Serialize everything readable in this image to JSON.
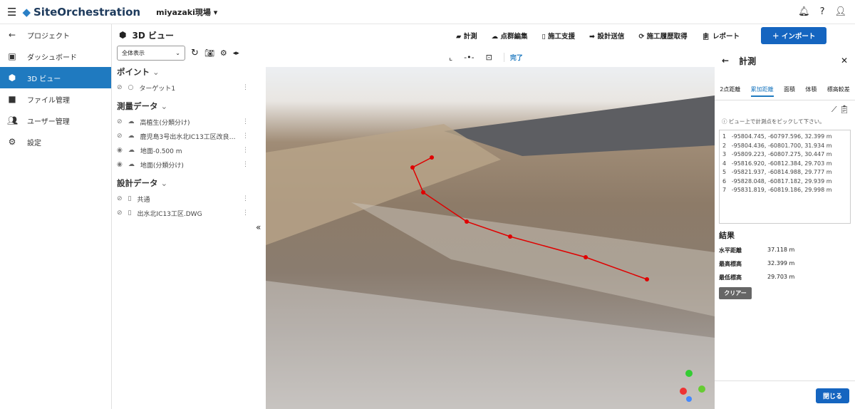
{
  "app": {
    "title": "SiteOrchestration",
    "project": "miyazaki現場"
  },
  "nav": [
    {
      "label": "プロジェクト",
      "icon": "arrow-left-icon"
    },
    {
      "label": "ダッシュボード",
      "icon": "dashboard-icon"
    },
    {
      "label": "3D ビュー",
      "icon": "cube-icon",
      "active": true
    },
    {
      "label": "ファイル管理",
      "icon": "folder-icon"
    },
    {
      "label": "ユーザー管理",
      "icon": "users-icon"
    },
    {
      "label": "設定",
      "icon": "gear-icon"
    }
  ],
  "layers": {
    "title": "3D ビュー",
    "view_select": "全体表示",
    "sections": [
      {
        "title": "ポイント",
        "items": [
          {
            "label": "ターゲット1",
            "visible": false
          }
        ]
      },
      {
        "title": "測量データ",
        "items": [
          {
            "label": "高植生(分類分け)",
            "visible": false
          },
          {
            "label": "鹿児島3号出水北IC13工区改良…",
            "visible": false
          },
          {
            "label": "地面-0.500 m",
            "visible": true
          },
          {
            "label": "地面(分類分け)",
            "visible": true
          }
        ]
      },
      {
        "title": "設計データ",
        "items": [
          {
            "label": "共通",
            "visible": false
          },
          {
            "label": "出水北IC13工区.DWG",
            "visible": false
          }
        ]
      }
    ]
  },
  "toolbar": {
    "items": [
      "計測",
      "点群編集",
      "施工支援",
      "設計送信",
      "施工履歴取得",
      "レポート"
    ],
    "import": "インポート",
    "done": "完了"
  },
  "measure": {
    "title": "計測",
    "tabs": [
      "2点距離",
      "累加距離",
      "面積",
      "体積",
      "標高較差"
    ],
    "active_tab": "累加距離",
    "hint": "ビュー上で計測点をピックして下さい。",
    "points": [
      "-95804.745, -60797.596, 32.399 m",
      "-95804.436, -60801.700, 31.934 m",
      "-95809.223, -60807.275, 30.447 m",
      "-95816.920, -60812.384, 29.703 m",
      "-95821.937, -60814.988, 29.777 m",
      "-95828.048, -60817.182, 29.939 m",
      "-95831.819, -60819.186, 29.998 m"
    ],
    "result_title": "結果",
    "results": [
      {
        "label": "水平距離",
        "value": "37.118 m"
      },
      {
        "label": "最高標高",
        "value": "32.399 m"
      },
      {
        "label": "最低標高",
        "value": "29.703 m"
      }
    ],
    "clear": "クリアー",
    "close": "閉じる"
  },
  "colors": {
    "accent": "#1f7ac0",
    "measure_line": "#e00000"
  }
}
